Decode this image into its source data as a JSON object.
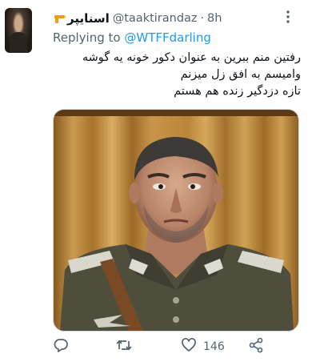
{
  "tweet": {
    "display_name": "اسنایپر",
    "handle": "@taaktirandaz",
    "separator": "·",
    "time": "8h",
    "reply_prefix": "Replying to",
    "reply_to": "@WTFFdarling",
    "text_lines": [
      "رفتین منم ببرین به عنوان دکور خونه یه گوشه",
      "وامیسم به افق زل میزنم",
      "تازه دزدگیر زنده هم هستم"
    ]
  },
  "actions": {
    "reply_icon": "comment-icon",
    "retweet_icon": "retweet-icon",
    "like_icon": "heart-icon",
    "like_count": "146",
    "share_icon": "share-icon"
  },
  "colors": {
    "accent": "#1d9bf0",
    "muted": "#536471",
    "text": "#0f1419"
  }
}
